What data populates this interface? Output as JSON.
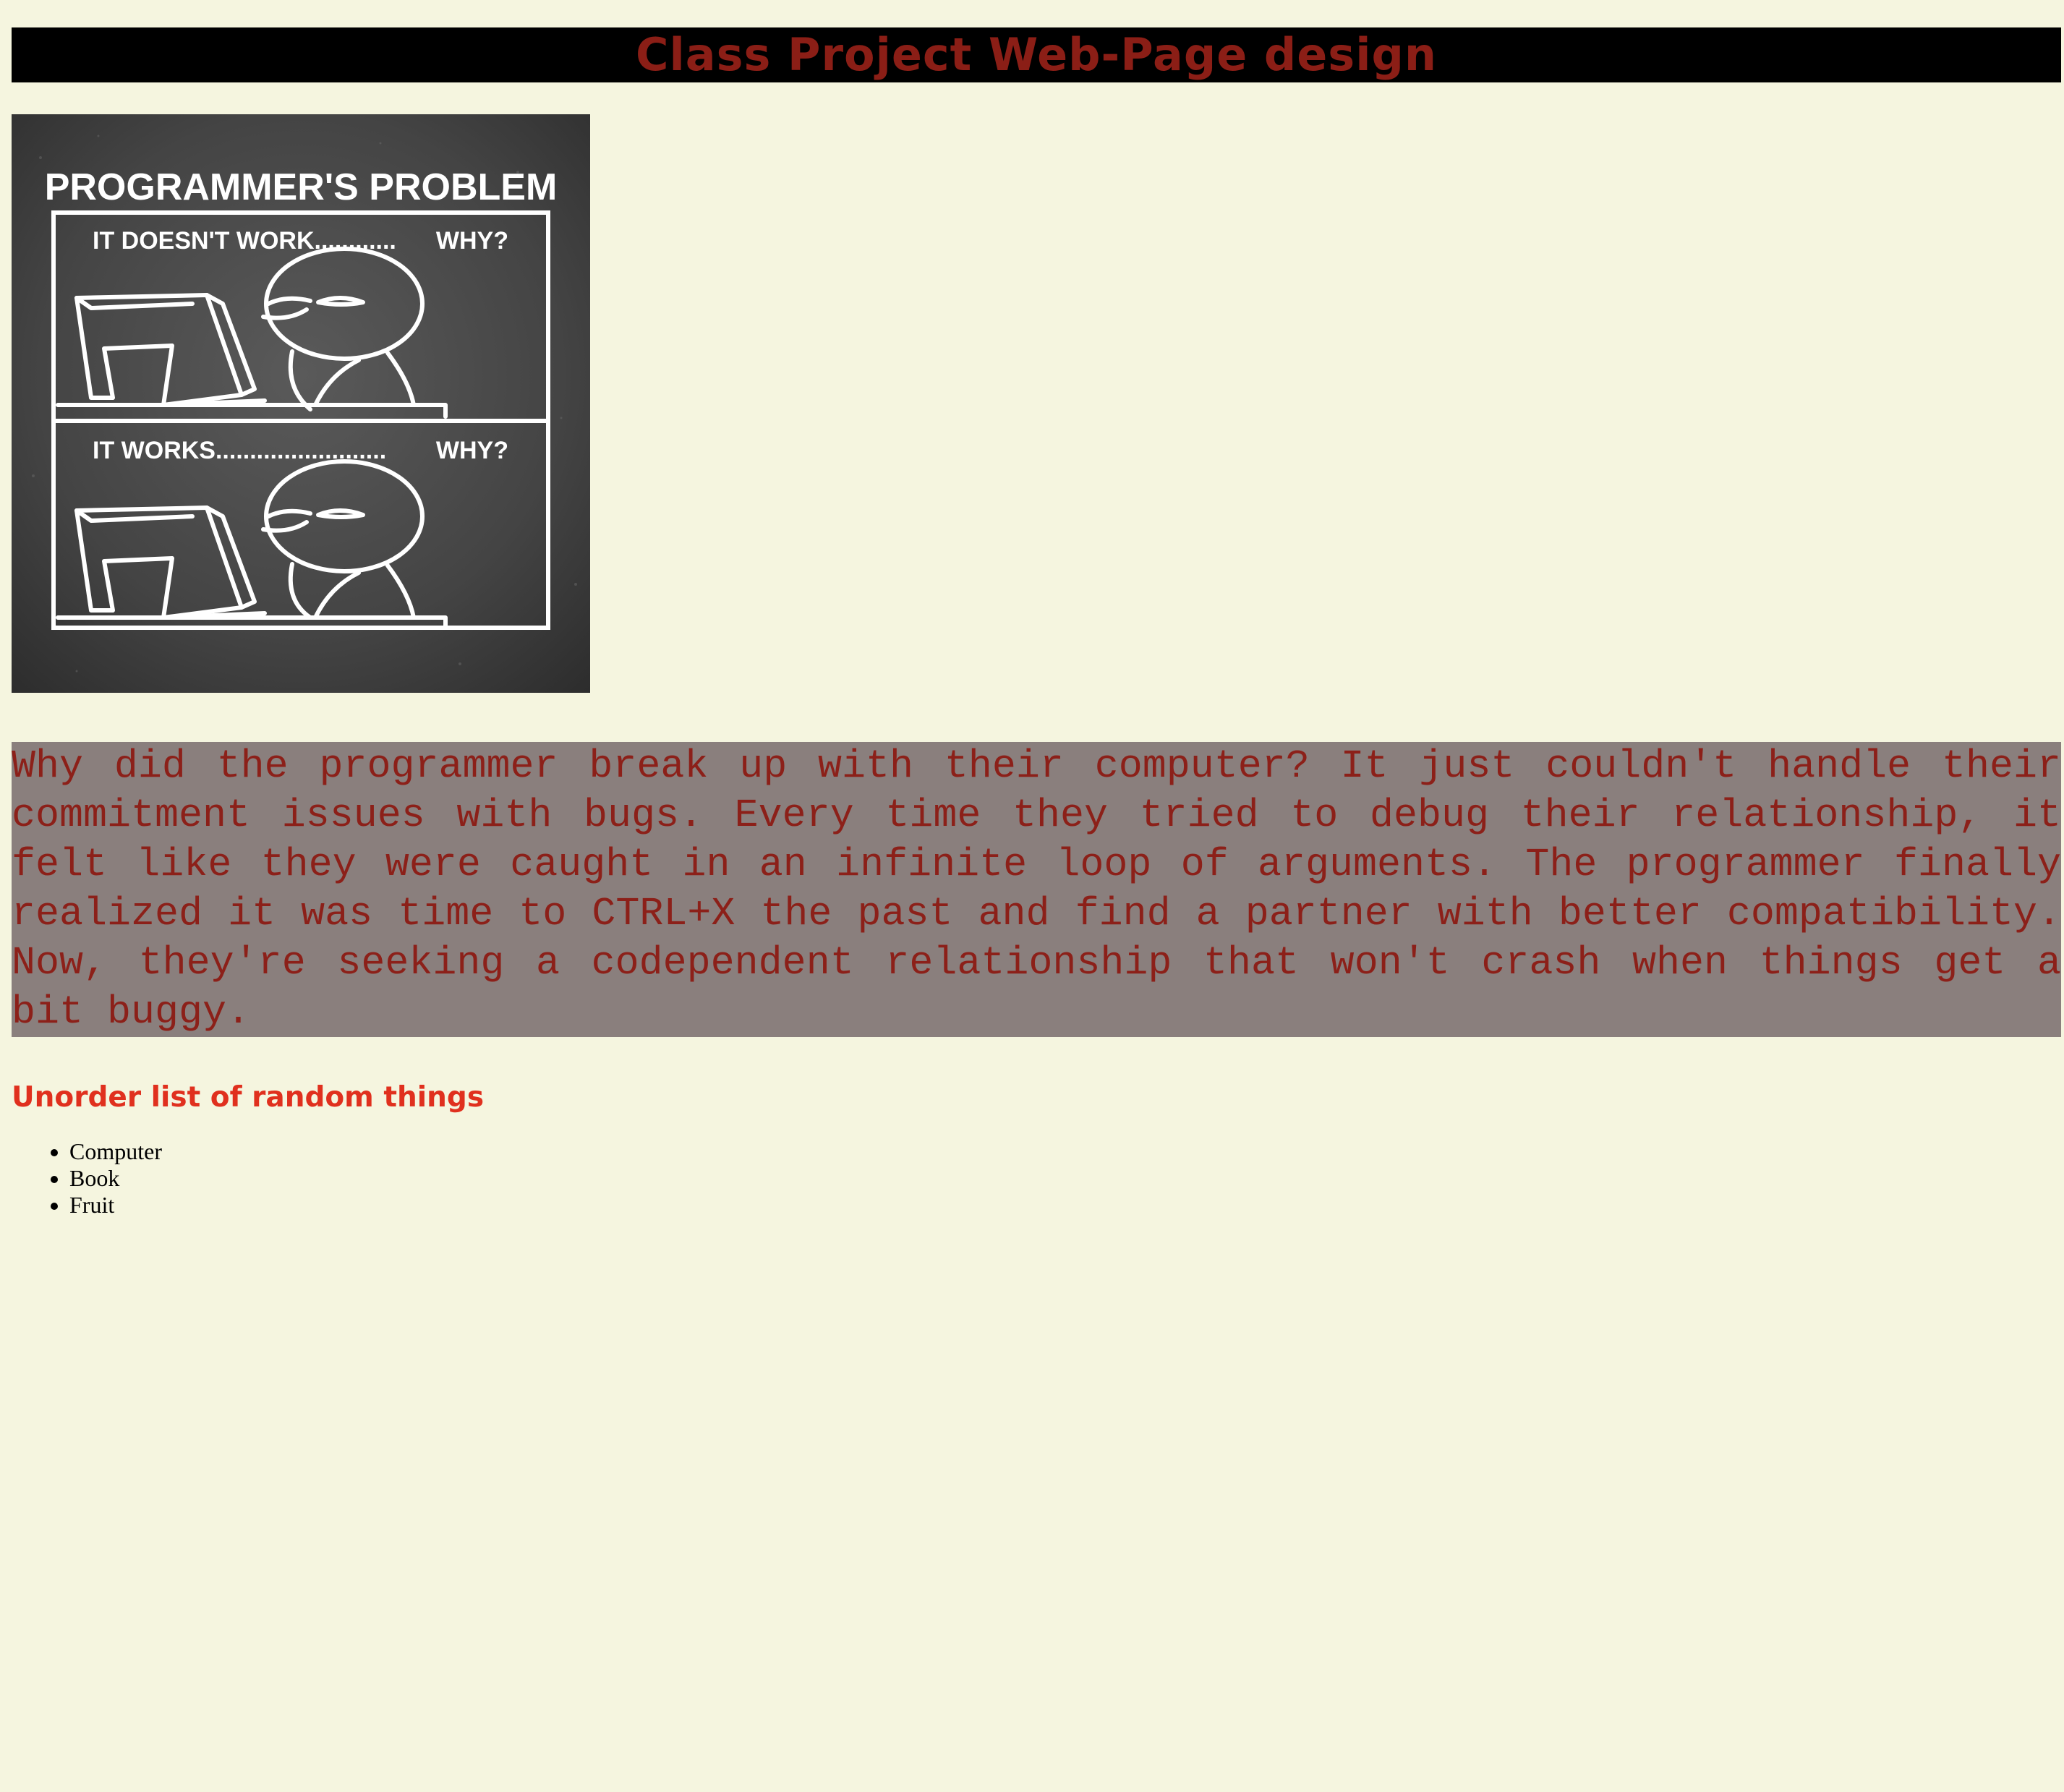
{
  "page": {
    "title": "Class Project Web-Page design",
    "background_color": "#f5f5df",
    "title_bar_color": "#000000",
    "title_text_color": "#8b1e16"
  },
  "comic": {
    "heading": "PROGRAMMER'S PROBLEM",
    "panel_top_caption_left": "IT DOESN'T WORK............",
    "panel_top_caption_right": "WHY?",
    "panel_bottom_caption_left": "IT WORKS.........................",
    "panel_bottom_caption_right": "WHY?"
  },
  "joke": {
    "text": "Why did the programmer break up with their computer? It just couldn't handle their commitment issues with bugs. Every time they tried to debug their relationship, it felt like they were caught in an infinite loop of arguments. The programmer finally realized it was time to CTRL+X the past and find a partner with better compatibility. Now, they're seeking a codependent relationship that won't crash when things get a bit buggy.",
    "background_color": "#8a7f7d",
    "text_color": "#8c2019"
  },
  "list_section": {
    "heading": "Unorder list of random things",
    "heading_color": "#e0301e",
    "items": [
      "Computer",
      "Book",
      "Fruit"
    ]
  }
}
